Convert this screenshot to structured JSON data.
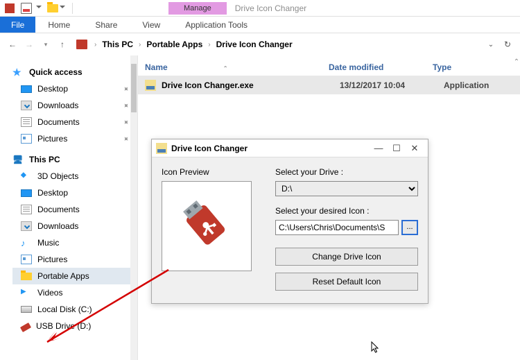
{
  "titlebar": {
    "context_tab": "Manage",
    "title": "Drive Icon Changer"
  },
  "ribbon": {
    "file": "File",
    "tabs": [
      "Home",
      "Share",
      "View"
    ],
    "app_tools": "Application Tools"
  },
  "breadcrumb": {
    "segments": [
      "This PC",
      "Portable Apps",
      "Drive Icon Changer"
    ]
  },
  "sidebar": {
    "quick_access": "Quick access",
    "quick": [
      "Desktop",
      "Downloads",
      "Documents",
      "Pictures"
    ],
    "this_pc": "This PC",
    "pc": [
      "3D Objects",
      "Desktop",
      "Documents",
      "Downloads",
      "Music",
      "Pictures",
      "Portable Apps",
      "Videos",
      "Local Disk (C:)",
      "USB Drive (D:)"
    ]
  },
  "columns": {
    "name": "Name",
    "date": "Date modified",
    "type": "Type"
  },
  "rows": [
    {
      "name": "Drive Icon Changer.exe",
      "date": "13/12/2017 10:04",
      "type": "Application"
    }
  ],
  "dialog": {
    "title": "Drive Icon Changer",
    "preview_label": "Icon Preview",
    "select_drive_label": "Select your Drive :",
    "drive_value": "D:\\",
    "select_icon_label": "Select your desired Icon :",
    "icon_path": "C:\\Users\\Chris\\Documents\\S",
    "browse": "...",
    "change_btn": "Change Drive Icon",
    "reset_btn": "Reset Default Icon"
  }
}
